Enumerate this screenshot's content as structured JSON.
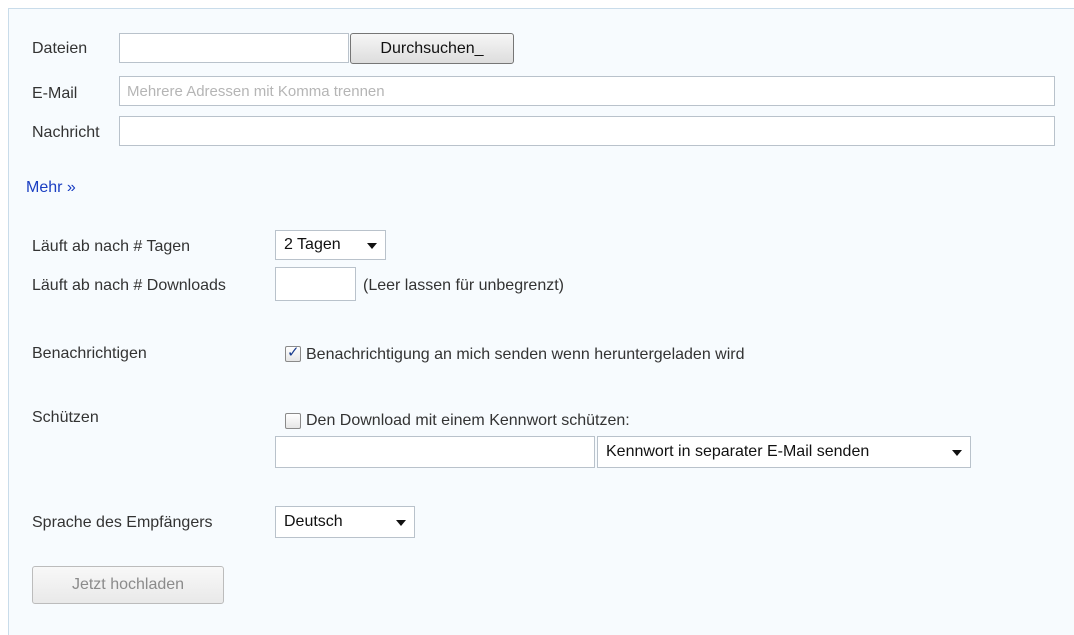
{
  "form": {
    "files": {
      "label": "Dateien",
      "value": "",
      "browse_label": "Durchsuchen_"
    },
    "email": {
      "label": "E-Mail",
      "value": "",
      "placeholder": "Mehrere Adressen mit Komma trennen"
    },
    "message": {
      "label": "Nachricht",
      "value": ""
    },
    "more_link": "Mehr »",
    "expire_days": {
      "label": "Läuft ab nach # Tagen",
      "selected": "2 Tagen"
    },
    "expire_downloads": {
      "label": "Läuft ab nach # Downloads",
      "value": "",
      "hint": "(Leer lassen für unbegrenzt)"
    },
    "notify": {
      "label": "Benachrichtigen",
      "checkbox_label": "Benachrichtigung an mich senden wenn heruntergeladen wird",
      "checked": true
    },
    "protect": {
      "label": "Schützen",
      "checkbox_label": "Den Download mit einem Kennwort schützen:",
      "checked": false,
      "password_value": "",
      "send_option_selected": "Kennwort in separater E-Mail senden"
    },
    "language": {
      "label": "Sprache des Empfängers",
      "selected": "Deutsch"
    },
    "submit_label": "Jetzt hochladen"
  }
}
